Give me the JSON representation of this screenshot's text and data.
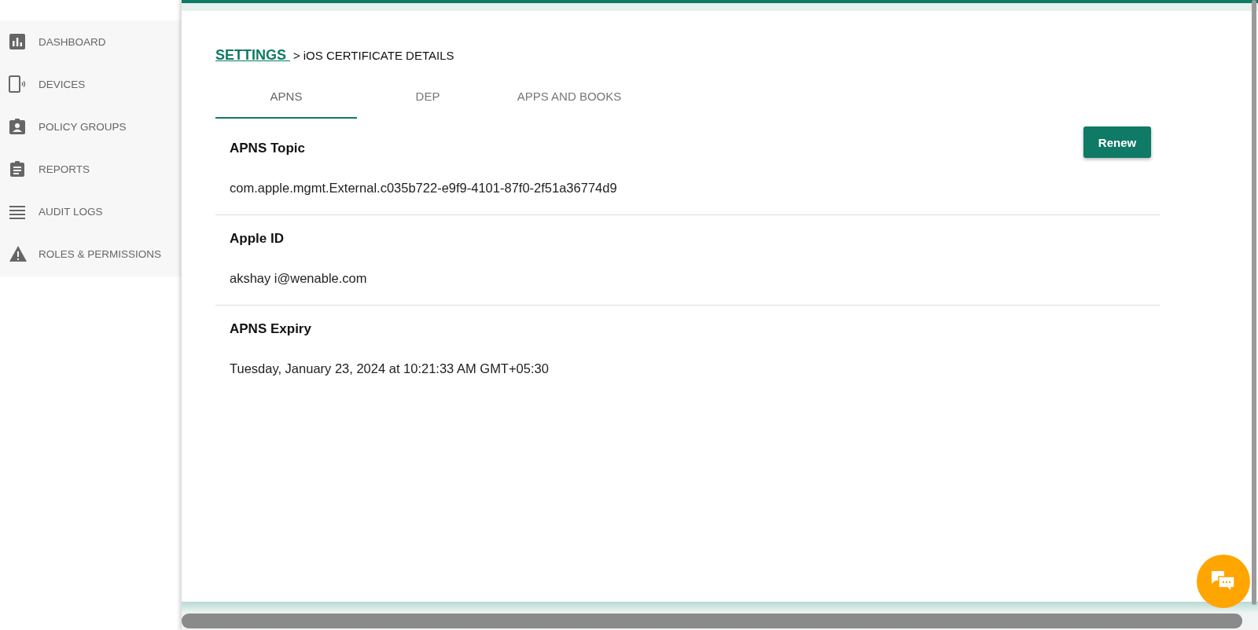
{
  "sidebar": {
    "items": [
      {
        "label": "DASHBOARD"
      },
      {
        "label": "DEVICES"
      },
      {
        "label": "POLICY GROUPS"
      },
      {
        "label": "REPORTS"
      },
      {
        "label": "AUDIT LOGS"
      },
      {
        "label": "ROLES & PERMISSIONS"
      }
    ]
  },
  "breadcrumb": {
    "link": "SETTINGS ",
    "separator": ">",
    "current": "iOS CERTIFICATE DETAILS"
  },
  "tabs": [
    {
      "label": "APNS",
      "selected": true
    },
    {
      "label": "DEP",
      "selected": false
    },
    {
      "label": "APPS AND BOOKS",
      "selected": false
    }
  ],
  "renew_button": "Renew",
  "fields": [
    {
      "label": "APNS Topic",
      "value": "com.apple.mgmt.External.c035b722-e9f9-4101-87f0-2f51a36774d9"
    },
    {
      "label": "Apple ID",
      "value": "akshay i@wenable.com"
    },
    {
      "label": "APNS Expiry",
      "value": "Tuesday, January 23, 2024 at 10:21:33 AM GMT+05:30"
    }
  ]
}
